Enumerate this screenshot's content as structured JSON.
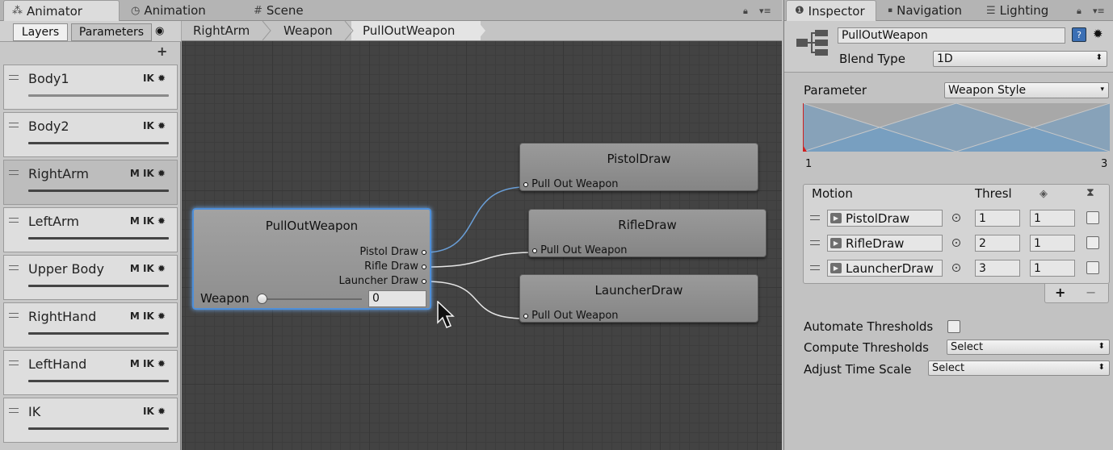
{
  "animator_window": {
    "tabs": [
      {
        "label": "Animator",
        "icon": "animator-icon"
      },
      {
        "label": "Animation",
        "icon": "clock-icon"
      },
      {
        "label": "Scene",
        "icon": "hash-icon"
      }
    ]
  },
  "layers_panel": {
    "tabs": [
      "Layers",
      "Parameters"
    ],
    "add_label": "+",
    "layers": [
      {
        "name": "Body1",
        "tags": "IK ✹"
      },
      {
        "name": "Body2",
        "tags": "IK ✹"
      },
      {
        "name": "RightArm",
        "tags": "M IK ✹"
      },
      {
        "name": "LeftArm",
        "tags": "M IK ✹"
      },
      {
        "name": "Upper Body",
        "tags": "M IK ✹"
      },
      {
        "name": "RightHand",
        "tags": "M IK ✹"
      },
      {
        "name": "LeftHand",
        "tags": "M IK ✹"
      },
      {
        "name": "IK",
        "tags": "IK ✹"
      }
    ]
  },
  "breadcrumb": [
    "RightArm",
    "Weapon",
    "PullOutWeapon"
  ],
  "graph": {
    "blend_node": {
      "title": "PullOutWeapon",
      "ports": [
        "Pistol Draw",
        "Rifle Draw",
        "Launcher Draw"
      ],
      "param_label": "Weapon",
      "param_value": "0"
    },
    "states": [
      {
        "title": "PistolDraw",
        "port": "Pull Out Weapon"
      },
      {
        "title": "RifleDraw",
        "port": "Pull Out Weapon"
      },
      {
        "title": "LauncherDraw",
        "port": "Pull Out Weapon"
      }
    ]
  },
  "inspector": {
    "tabs": [
      {
        "label": "Inspector",
        "icon": "info-icon"
      },
      {
        "label": "Navigation",
        "icon": "nav-icon"
      },
      {
        "label": "Lighting",
        "icon": "lighting-icon"
      }
    ],
    "name": "PullOutWeapon",
    "blend_type_label": "Blend Type",
    "blend_type_value": "1D",
    "parameter_label": "Parameter",
    "parameter_value": "Weapon Style",
    "range_min": "1",
    "range_max": "3",
    "motion_header": {
      "motion": "Motion",
      "threshold": "Thresl"
    },
    "motions": [
      {
        "clip": "PistolDraw",
        "threshold": "1",
        "speed": "1",
        "mirror": false
      },
      {
        "clip": "RifleDraw",
        "threshold": "2",
        "speed": "1",
        "mirror": false
      },
      {
        "clip": "LauncherDraw",
        "threshold": "3",
        "speed": "1",
        "mirror": false
      }
    ],
    "add_label": "+",
    "remove_label": "−",
    "automate_label": "Automate Thresholds",
    "compute_label": "Compute Thresholds",
    "compute_value": "Select",
    "adjust_label": "Adjust Time Scale",
    "adjust_value": "Select"
  },
  "colors": {
    "selection_blue": "#4e8fd9",
    "graph_background": "#434343",
    "blend_graph_fill": "#6c9cc7"
  }
}
